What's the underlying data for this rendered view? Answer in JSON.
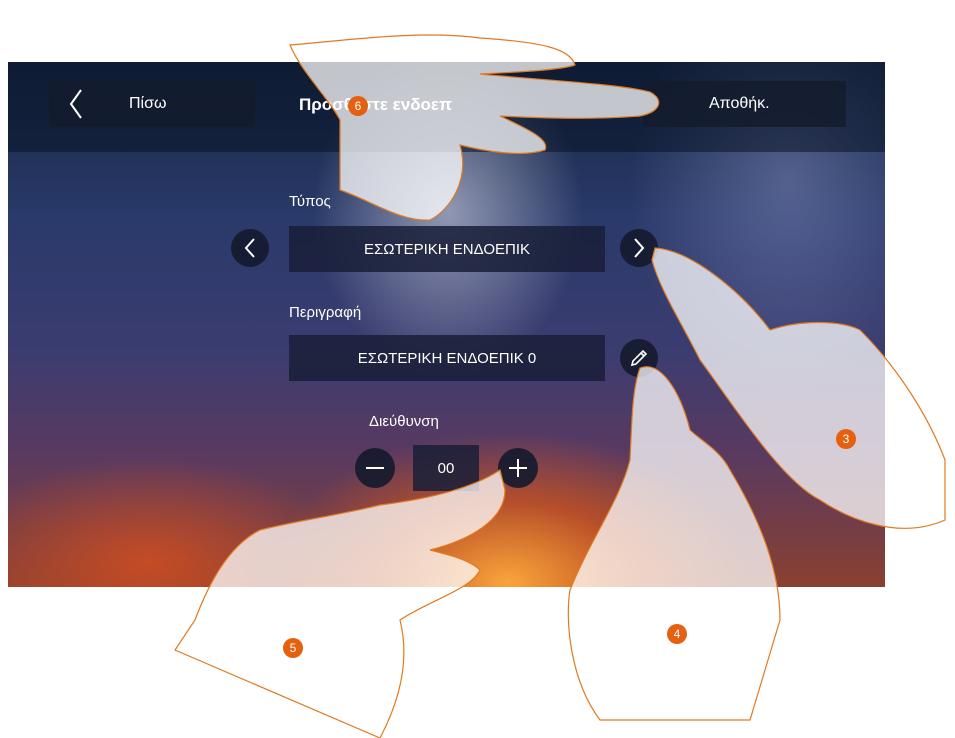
{
  "header": {
    "back_label": "Πίσω",
    "title": "Προσθέστε ενδοεπ",
    "save_label": "Αποθήκ."
  },
  "form": {
    "type_label": "Τύπος",
    "type_value": "ΕΣΩΤΕΡΙΚΗ ΕΝΔΟΕΠΙΚ",
    "description_label": "Περιγραφή",
    "description_value": "ΕΣΩΤΕΡΙΚΗ ΕΝΔΟΕΠΙΚ 0",
    "address_label": "Διεύθυνση",
    "address_value": "00"
  },
  "callouts": {
    "c3": "3",
    "c4": "4",
    "c5": "5",
    "c6": "6"
  },
  "colors": {
    "callout": "#e5600f",
    "hand_outline": "#e07a20"
  },
  "icons": [
    "back-chevron-icon",
    "prev-chevron-icon",
    "next-chevron-icon",
    "pencil-icon",
    "minus-icon",
    "plus-icon"
  ]
}
